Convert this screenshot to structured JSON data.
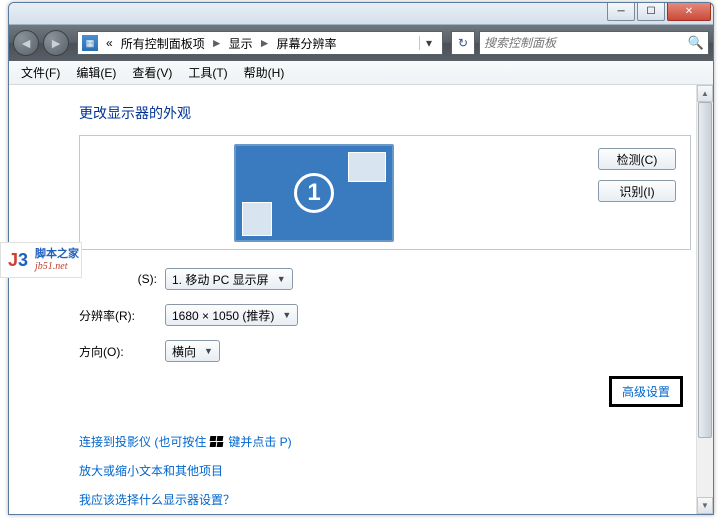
{
  "titlebar": {
    "min": "─",
    "max": "☐",
    "close": "✕"
  },
  "nav": {
    "back_glyph": "◄",
    "fwd_glyph": "►",
    "prefix": "«",
    "seg1": "所有控制面板项",
    "seg2": "显示",
    "seg3": "屏幕分辨率",
    "sep": "►",
    "drop": "▾",
    "refresh": "↻",
    "search_placeholder": "搜索控制面板",
    "search_glyph": "🔍"
  },
  "menu": {
    "file": "文件(F)",
    "edit": "编辑(E)",
    "view": "查看(V)",
    "tools": "工具(T)",
    "help": "帮助(H)"
  },
  "heading": "更改显示器的外观",
  "monitor": {
    "number": "1",
    "detect": "检测(C)",
    "identify": "识别(I)"
  },
  "form": {
    "display_label": "显示器(S):",
    "display_label_partial": "(S):",
    "display_value": "1. 移动 PC 显示屏",
    "res_label": "分辨率(R):",
    "res_value": "1680 × 1050 (推荐)",
    "orient_label": "方向(O):",
    "orient_value": "横向",
    "arrow": "▼"
  },
  "advanced": "高级设置",
  "links": {
    "projector_a": "连接到投影仪 (也可按住",
    "projector_b": "键并点击 P)",
    "textsize": "放大或缩小文本和其他项目",
    "which": "我应该选择什么显示器设置？"
  },
  "scrollbar": {
    "up": "▲",
    "down": "▼"
  },
  "watermark": {
    "cn": "脚本之家",
    "url": "jb51.net"
  }
}
